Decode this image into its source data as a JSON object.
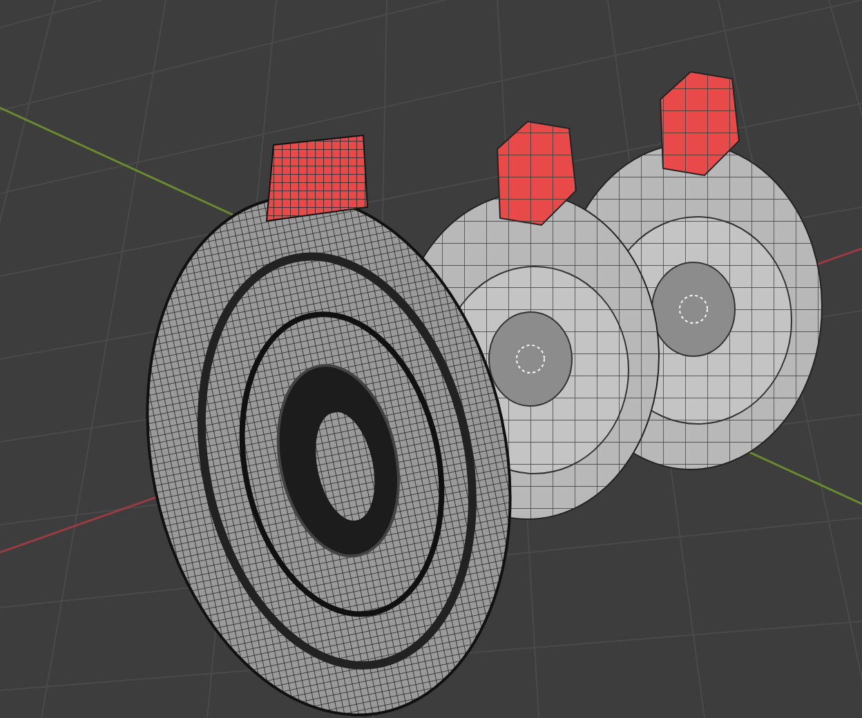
{
  "viewport": {
    "meshes": [
      {
        "kind": "coarse",
        "selected": true
      },
      {
        "kind": "coarse",
        "selected": true
      },
      {
        "kind": "dense",
        "selected": true
      }
    ]
  }
}
